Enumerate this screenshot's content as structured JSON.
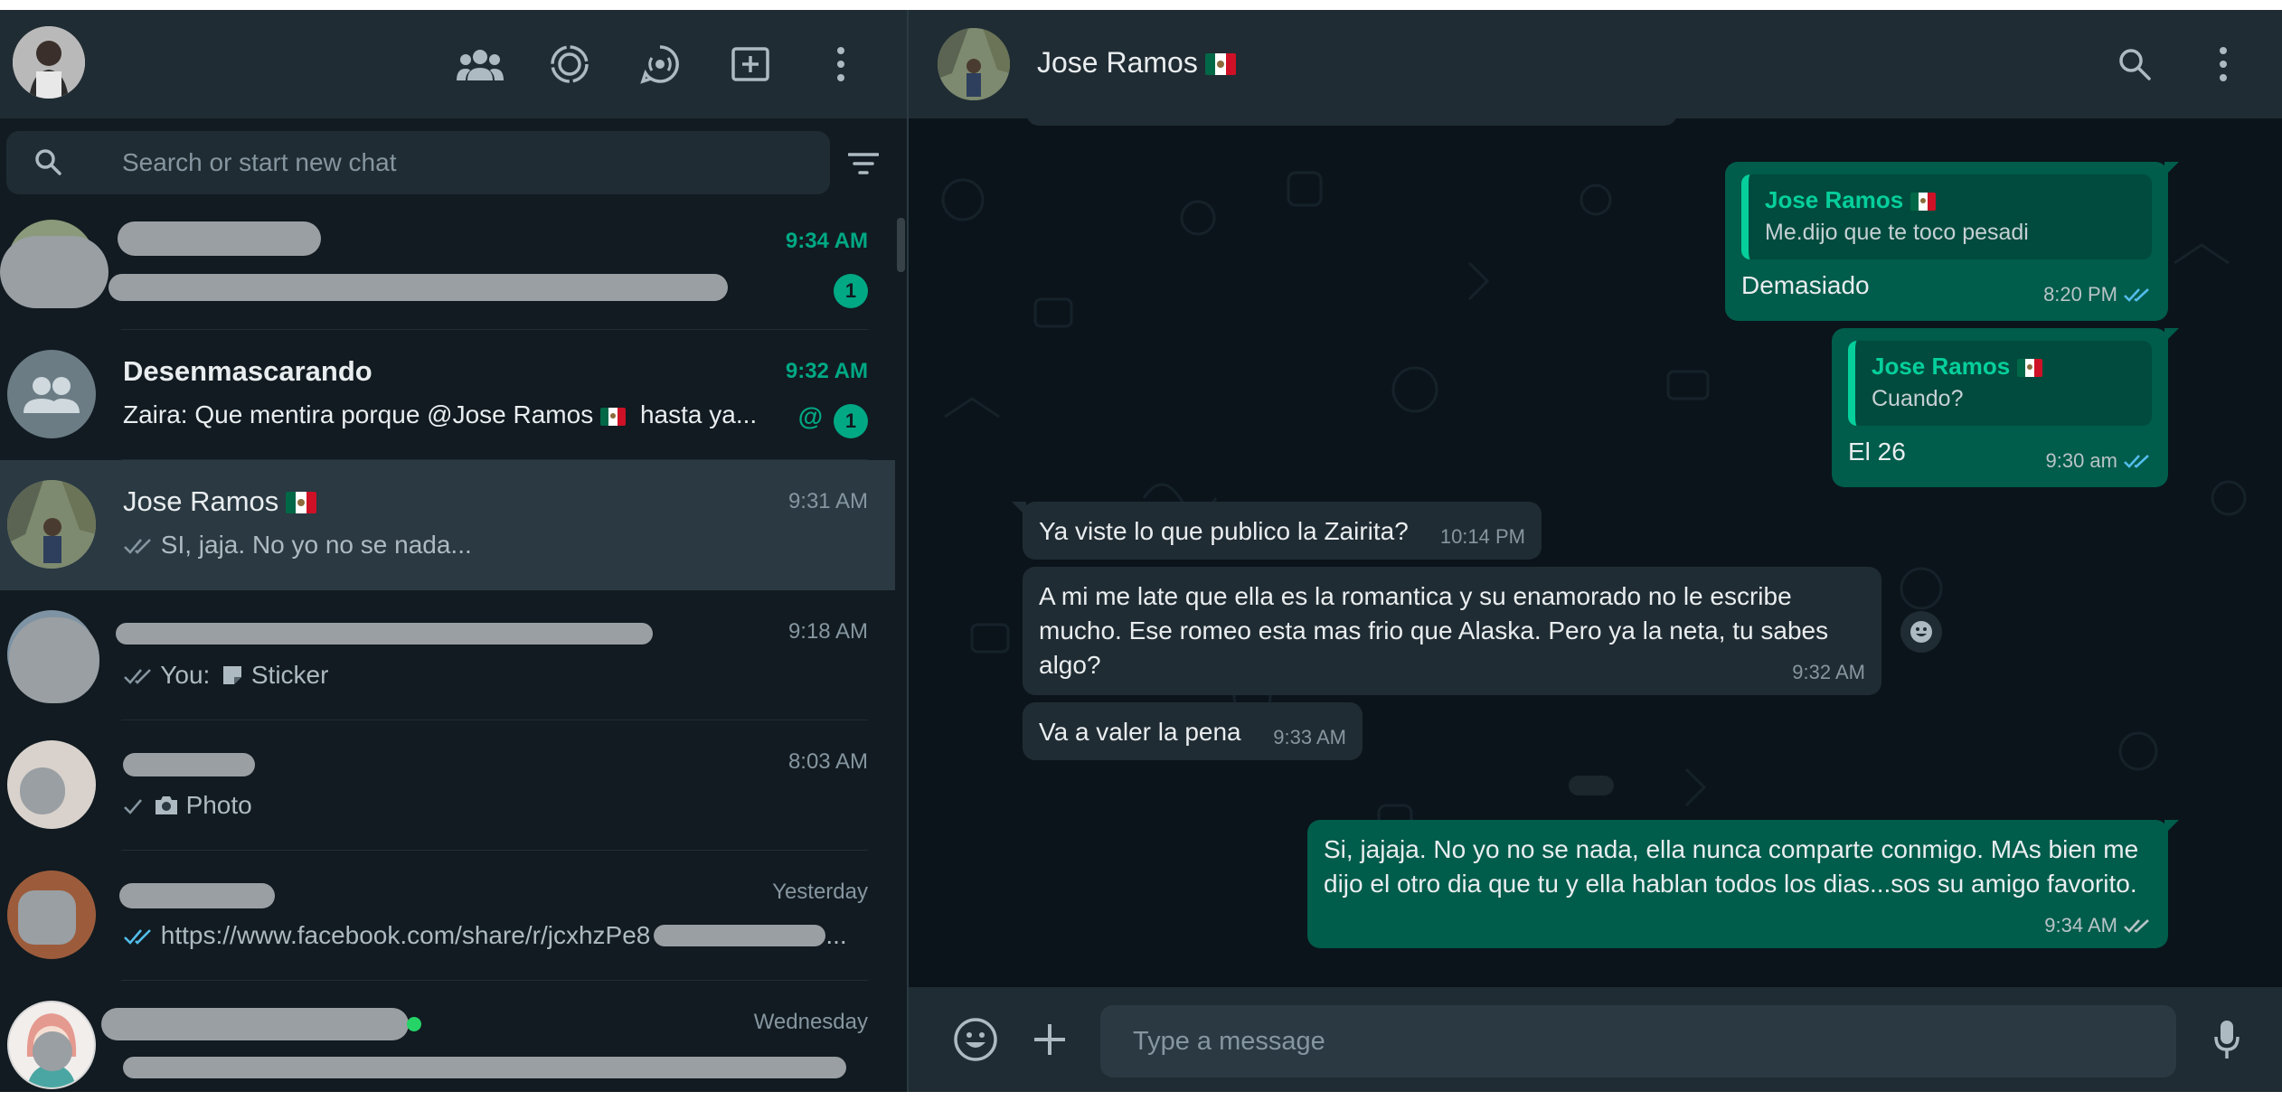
{
  "left_header": {
    "icons": [
      "communities-icon",
      "status-icon",
      "channels-icon",
      "new-chat-icon",
      "menu-icon"
    ]
  },
  "search": {
    "placeholder": "Search or start new chat"
  },
  "chats": [
    {
      "name": "",
      "time": "9:34 AM",
      "preview": "",
      "unread": "1",
      "redacted": true
    },
    {
      "name": "Desenmascarando",
      "time": "9:32 AM",
      "preview": "Zaira: Que mentira porque @Jose Ramos",
      "preview_tail": "hasta ya...",
      "mention": "@",
      "unread": "1"
    },
    {
      "name": "Jose Ramos",
      "time": "9:31 AM",
      "preview": "SI, jaja. No yo no se nada...",
      "active": true
    },
    {
      "name": "",
      "time": "9:18 AM",
      "preview": "You:",
      "preview_tail": "Sticker"
    },
    {
      "name": "",
      "time": "8:03 AM",
      "preview": "Photo"
    },
    {
      "name": "",
      "time": "Yesterday",
      "preview": "https://www.facebook.com/share/r/jcxhzPe8",
      "preview_tail": "..."
    },
    {
      "name": "",
      "time": "Wednesday",
      "preview": ""
    }
  ],
  "conversation": {
    "contact_name": "Jose Ramos",
    "messages": [
      {
        "dir": "out",
        "quote_name": "Jose Ramos",
        "quote_text": "Me.dijo que te toco pesadi",
        "text": "Demasiado",
        "time": "8:20 PM"
      },
      {
        "dir": "out",
        "quote_name": "Jose Ramos",
        "quote_text": "Cuando?",
        "text": "El 26",
        "time": "9:30 am"
      },
      {
        "dir": "in",
        "text": "Ya viste lo que publico la Zairita?",
        "time": "10:14 PM"
      },
      {
        "dir": "in",
        "text": "A mi me late que ella es la romantica y su enamorado no le escribe mucho. Ese romeo esta mas frio que Alaska. Pero ya la neta, tu sabes algo?",
        "time": "9:32 AM"
      },
      {
        "dir": "in",
        "text": "Va a valer la pena",
        "time": "9:33 AM"
      },
      {
        "dir": "out",
        "text": "Si, jajaja. No yo no se nada, ella nunca comparte conmigo. MAs bien me dijo el otro dia que tu y ella hablan todos los dias...sos su amigo favorito.",
        "time": "9:34 AM"
      }
    ]
  },
  "composer": {
    "placeholder": "Type a message"
  },
  "colors": {
    "accent": "#00a884",
    "outgoing_bubble": "#005c4b",
    "incoming_bubble": "#202c33",
    "panel": "#202c33",
    "background": "#111b21",
    "read_tick": "#53bdeb"
  }
}
